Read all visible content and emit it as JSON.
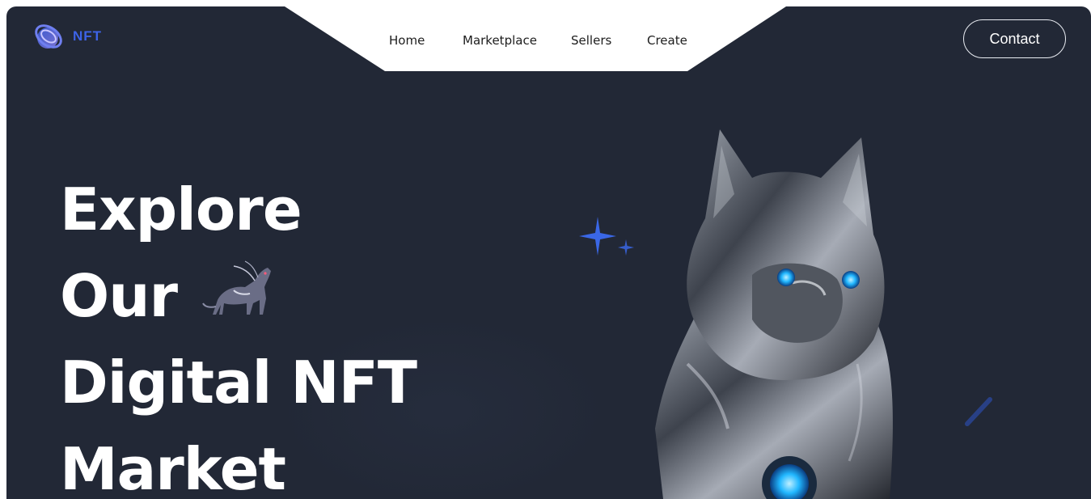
{
  "brand": {
    "name": "NFT",
    "logo_icon": "ringed-planet-logo-icon",
    "accent": "#3d63e8"
  },
  "nav": {
    "items": [
      {
        "label": "Home"
      },
      {
        "label": "Marketplace"
      },
      {
        "label": "Sellers"
      },
      {
        "label": "Create"
      }
    ]
  },
  "header": {
    "contact_label": "Contact"
  },
  "hero": {
    "lines": [
      "Explore",
      "Our",
      "Digital NFT",
      "Market"
    ],
    "inline_image": "robotic-creature-icon",
    "feature_image": "chrome-dog-statue-image",
    "background": "#222836"
  }
}
